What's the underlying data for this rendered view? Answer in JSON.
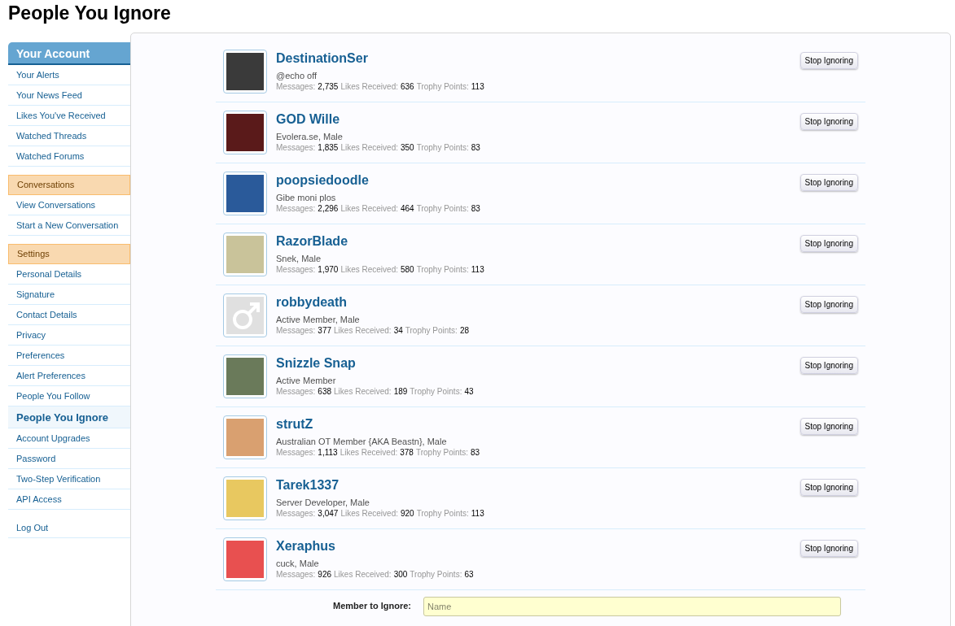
{
  "page_title": "People You Ignore",
  "sidebar": {
    "sections": [
      {
        "heading": "Your Account",
        "kind": "primary",
        "items": [
          {
            "label": "Your Alerts",
            "selected": false
          },
          {
            "label": "Your News Feed",
            "selected": false
          },
          {
            "label": "Likes You've Received",
            "selected": false
          },
          {
            "label": "Watched Threads",
            "selected": false
          },
          {
            "label": "Watched Forums",
            "selected": false
          }
        ]
      },
      {
        "heading": "Conversations",
        "kind": "secondary",
        "items": [
          {
            "label": "View Conversations",
            "selected": false
          },
          {
            "label": "Start a New Conversation",
            "selected": false
          }
        ]
      },
      {
        "heading": "Settings",
        "kind": "secondary",
        "items": [
          {
            "label": "Personal Details",
            "selected": false
          },
          {
            "label": "Signature",
            "selected": false
          },
          {
            "label": "Contact Details",
            "selected": false
          },
          {
            "label": "Privacy",
            "selected": false
          },
          {
            "label": "Preferences",
            "selected": false
          },
          {
            "label": "Alert Preferences",
            "selected": false
          },
          {
            "label": "People You Follow",
            "selected": false
          },
          {
            "label": "People You Ignore",
            "selected": true
          },
          {
            "label": "Account Upgrades",
            "selected": false
          },
          {
            "label": "Password",
            "selected": false
          },
          {
            "label": "Two-Step Verification",
            "selected": false
          },
          {
            "label": "API Access",
            "selected": false
          }
        ]
      },
      {
        "kind": "plain",
        "items": [
          {
            "label": "Log Out",
            "selected": false
          }
        ]
      }
    ]
  },
  "members": [
    {
      "name": "DestinationSer",
      "kind": "photo",
      "title": "@echo off",
      "stats": [
        {
          "label": "Messages:",
          "value": "2,735"
        },
        {
          "label": "Likes Received:",
          "value": "636"
        },
        {
          "label": "Trophy Points:",
          "value": "113"
        }
      ],
      "button": "Stop Ignoring"
    },
    {
      "name": "GOD Wille",
      "kind": "photo",
      "title": "Evolera.se, Male",
      "stats": [
        {
          "label": "Messages:",
          "value": "1,835"
        },
        {
          "label": "Likes Received:",
          "value": "350"
        },
        {
          "label": "Trophy Points:",
          "value": "83"
        }
      ],
      "button": "Stop Ignoring"
    },
    {
      "name": "poopsiedoodle",
      "kind": "photo",
      "title": "Gibe moni plos",
      "stats": [
        {
          "label": "Messages:",
          "value": "2,296"
        },
        {
          "label": "Likes Received:",
          "value": "464"
        },
        {
          "label": "Trophy Points:",
          "value": "83"
        }
      ],
      "button": "Stop Ignoring"
    },
    {
      "name": "RazorBlade",
      "kind": "photo",
      "title": "Snek, Male",
      "stats": [
        {
          "label": "Messages:",
          "value": "1,970"
        },
        {
          "label": "Likes Received:",
          "value": "580"
        },
        {
          "label": "Trophy Points:",
          "value": "113"
        }
      ],
      "button": "Stop Ignoring"
    },
    {
      "name": "robbydeath",
      "kind": "default",
      "title": "Active Member, Male",
      "stats": [
        {
          "label": "Messages:",
          "value": "377"
        },
        {
          "label": "Likes Received:",
          "value": "34"
        },
        {
          "label": "Trophy Points:",
          "value": "28"
        }
      ],
      "button": "Stop Ignoring"
    },
    {
      "name": "Snizzle Snap",
      "kind": "photo",
      "title": "Active Member",
      "stats": [
        {
          "label": "Messages:",
          "value": "638"
        },
        {
          "label": "Likes Received:",
          "value": "189"
        },
        {
          "label": "Trophy Points:",
          "value": "43"
        }
      ],
      "button": "Stop Ignoring"
    },
    {
      "name": "strutZ",
      "kind": "photo",
      "title": "Australian OT Member {AKA Beastn}, Male",
      "stats": [
        {
          "label": "Messages:",
          "value": "1,113"
        },
        {
          "label": "Likes Received:",
          "value": "378"
        },
        {
          "label": "Trophy Points:",
          "value": "83"
        }
      ],
      "button": "Stop Ignoring"
    },
    {
      "name": "Tarek1337",
      "kind": "photo",
      "title": "Server Developer, Male",
      "stats": [
        {
          "label": "Messages:",
          "value": "3,047"
        },
        {
          "label": "Likes Received:",
          "value": "920"
        },
        {
          "label": "Trophy Points:",
          "value": "113"
        }
      ],
      "button": "Stop Ignoring"
    },
    {
      "name": "Xeraphus",
      "kind": "photo",
      "title": "cuck, Male",
      "stats": [
        {
          "label": "Messages:",
          "value": "926"
        },
        {
          "label": "Likes Received:",
          "value": "300"
        },
        {
          "label": "Trophy Points:",
          "value": "63"
        }
      ],
      "button": "Stop Ignoring"
    }
  ],
  "ignore_form": {
    "label": "Member to Ignore:",
    "placeholder": "Name"
  }
}
